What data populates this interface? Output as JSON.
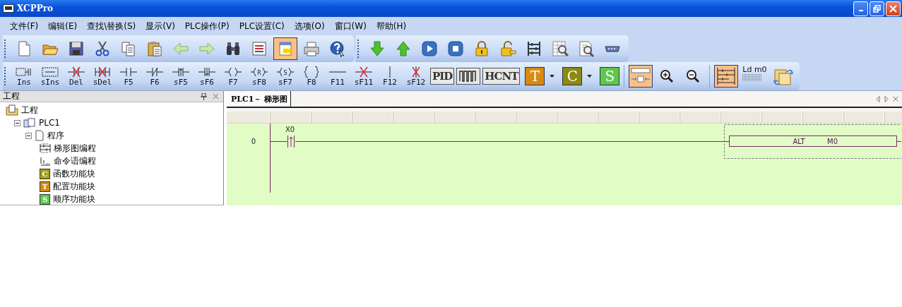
{
  "window": {
    "title": "XCPPro"
  },
  "menu": [
    "文件(F)",
    "编辑(E)",
    "查找\\替换(S)",
    "显示(V)",
    "PLC操作(P)",
    "PLC设置(C)",
    "选项(O)",
    "窗口(W)",
    "帮助(H)"
  ],
  "toolbar_file": [
    {
      "selected": false
    },
    {
      "selected": false
    },
    {
      "selected": false
    },
    {
      "selected": false
    },
    {
      "selected": false
    },
    {
      "selected": false
    },
    {
      "selected": false
    },
    {
      "selected": false
    },
    {
      "selected": false
    },
    {
      "selected": false
    },
    {
      "selected": true
    },
    {
      "selected": false
    },
    {
      "selected": false
    }
  ],
  "toolbar_plc": [
    {
      "selected": false
    },
    {
      "selected": false
    },
    {
      "selected": false
    },
    {
      "selected": false
    },
    {
      "selected": false
    },
    {
      "selected": false
    },
    {
      "selected": false
    },
    {
      "selected": false
    },
    {
      "selected": false
    },
    {
      "selected": false
    }
  ],
  "toolbar_ladder": [
    {
      "label": "Ins"
    },
    {
      "label": "sIns"
    },
    {
      "label": "Del"
    },
    {
      "label": "sDel"
    },
    {
      "label": "F5"
    },
    {
      "label": "F6"
    },
    {
      "label": "sF5"
    },
    {
      "label": "sF6"
    },
    {
      "label": "F7"
    },
    {
      "label": "sF8",
      "mark": "R"
    },
    {
      "label": "sF7",
      "mark": "S"
    },
    {
      "label": "F8"
    },
    {
      "label": "F11"
    },
    {
      "label": "sF11"
    },
    {
      "label": "F12"
    },
    {
      "label": "sF12"
    }
  ],
  "toolbar_blocks": [
    {
      "kind": "text",
      "text": "PID"
    },
    {
      "kind": "pulse"
    },
    {
      "kind": "text",
      "text": "HCNT"
    },
    {
      "kind": "letter",
      "text": "T",
      "color": "#d88a10",
      "dropdown": true
    },
    {
      "kind": "letter",
      "text": "C",
      "color": "#8c8a12",
      "dropdown": true
    },
    {
      "kind": "letter",
      "text": "S",
      "color": "#5ec84c",
      "dropdown": false
    }
  ],
  "toolbar_view": [
    {
      "kind": "layout",
      "selected": true
    },
    {
      "kind": "zoom_in",
      "selected": false
    },
    {
      "kind": "zoom_out",
      "selected": false
    }
  ],
  "toolbar_mode": [
    {
      "kind": "ladder",
      "selected": true
    },
    {
      "kind": "caption",
      "text": "Ld m0",
      "selected": false
    },
    {
      "kind": "convert",
      "selected": false
    }
  ],
  "project_panel": {
    "title": "工程",
    "tree": [
      {
        "kind": "project",
        "label": "工程",
        "children": [
          {
            "kind": "plc",
            "label": "PLC1",
            "expanded": true,
            "children": [
              {
                "kind": "program",
                "label": "程序",
                "expanded": true,
                "children": [
                  {
                    "kind": "ladder",
                    "label": "梯形图编程"
                  },
                  {
                    "kind": "statement",
                    "label": "命令语编程"
                  },
                  {
                    "kind": "block",
                    "badge": "C",
                    "color": "#a8a012",
                    "label": "函数功能块"
                  },
                  {
                    "kind": "block",
                    "badge": "T",
                    "color": "#d88a10",
                    "label": "配置功能块"
                  },
                  {
                    "kind": "block",
                    "badge": "S",
                    "color": "#5ec84c",
                    "label": "顺序功能块"
                  }
                ]
              }
            ]
          }
        ]
      }
    ]
  },
  "editor": {
    "tab": {
      "label": "PLC1－ 梯形图",
      "selected": true
    },
    "rungs": [
      {
        "number": "0",
        "contact": {
          "label": "X0",
          "kind": "rising"
        },
        "instruction": {
          "op": "ALT",
          "operand": "M0",
          "selected": true
        }
      }
    ]
  }
}
